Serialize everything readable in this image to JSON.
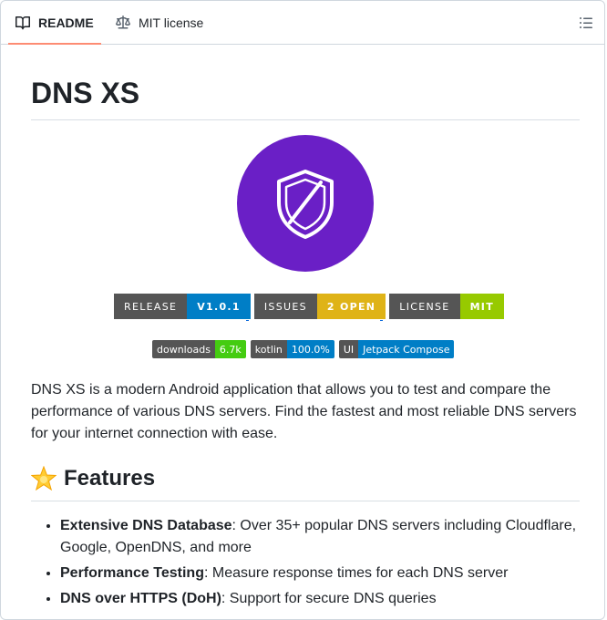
{
  "tabs": [
    {
      "label": "README",
      "icon": "book-icon",
      "active": true
    },
    {
      "label": "MIT license",
      "icon": "law-icon",
      "active": false
    }
  ],
  "toc_icon": "list-unordered-icon",
  "readme": {
    "title": "DNS XS",
    "logo_icon": "shield-slash-icon",
    "logo_color": "#6a1fc6",
    "badges_large": [
      {
        "label": "RELEASE",
        "value": "V1.0.1",
        "color": "#007ec6"
      },
      {
        "label": "ISSUES",
        "value": "2 OPEN",
        "color": "#dfb317"
      },
      {
        "label": "LICENSE",
        "value": "MIT",
        "color": "#97ca00"
      }
    ],
    "badges_small": [
      {
        "label": "downloads",
        "value": "6.7k",
        "color": "#4c1"
      },
      {
        "label": "kotlin",
        "value": "100.0%",
        "color": "#007ec6"
      },
      {
        "label": "UI",
        "value": "Jetpack Compose",
        "color": "#007ec6"
      }
    ],
    "description": "DNS XS is a modern Android application that allows you to test and compare the performance of various DNS servers. Find the fastest and most reliable DNS servers for your internet connection with ease.",
    "features_heading": "Features",
    "features_emoji": "star-icon",
    "features": [
      {
        "title": "Extensive DNS Database",
        "text": ": Over 35+ popular DNS servers including Cloudflare, Google, OpenDNS, and more"
      },
      {
        "title": "Performance Testing",
        "text": ": Measure response times for each DNS server"
      },
      {
        "title": "DNS over HTTPS (DoH)",
        "text": ": Support for secure DNS queries"
      }
    ]
  }
}
